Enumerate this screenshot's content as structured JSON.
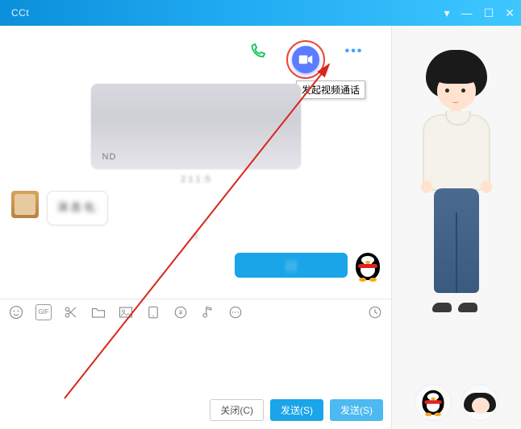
{
  "titlebar": {
    "title": "CCt"
  },
  "call": {
    "tooltip": "发起视频通话",
    "voice_icon": "phone-icon",
    "video_icon": "video-icon",
    "more_icon": "dots-icon"
  },
  "messages": {
    "timestamp1": "2    1 1   :5",
    "incoming_text": "消                                          态\n                                              化.",
    "timestamp2": "       5",
    "outgoing_text": "[            ]"
  },
  "toolbar": {
    "emoji": "emoji-icon",
    "gif_label": "GIF",
    "scissors": "scissors-icon",
    "folder": "folder-icon",
    "image": "image-icon",
    "capture": "capture-icon",
    "money": "money-icon",
    "music": "music-icon",
    "more": "more-icon",
    "history": "history-icon"
  },
  "buttons": {
    "close": "关闭(C)",
    "send": "发送(S)",
    "send2": "发送(S)"
  }
}
